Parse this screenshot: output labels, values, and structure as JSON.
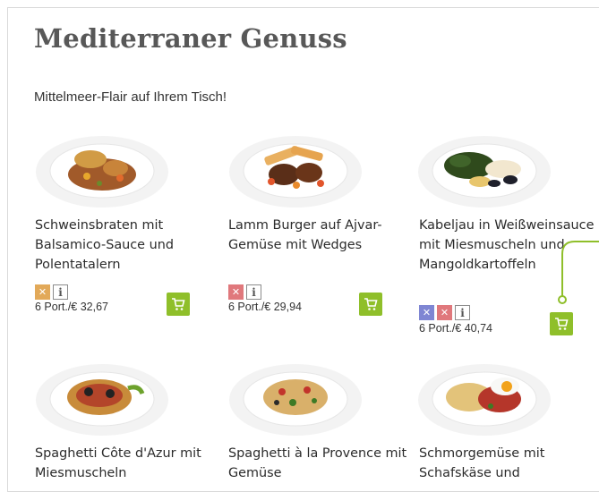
{
  "section": {
    "title": "Mediterraner Genuss",
    "subtitle": "Mittelmeer-Flair auf Ihrem Tisch!"
  },
  "products": [
    {
      "name": "Schweinsbraten mit Balsamico-Sauce und Polentatalern",
      "allergens": [
        "wheat-icon"
      ],
      "price": "6 Port./€ 32,67"
    },
    {
      "name": "Lamm Burger auf Ajvar-Gemüse mit Wedges",
      "allergens": [
        "milk-icon"
      ],
      "price": "6 Port./€ 29,94"
    },
    {
      "name": "Kabeljau in Weißweinsauce mit Miesmuscheln und Mangoldkartoffeln",
      "allergens": [
        "fish-icon",
        "milk-icon"
      ],
      "price": "6 Port./€ 40,74"
    },
    {
      "name": "Spaghetti Côte d'Azur mit Miesmuscheln"
    },
    {
      "name": "Spaghetti à la Provence mit Gemüse"
    },
    {
      "name": "Schmorgemüse mit Schafskäse und"
    }
  ],
  "colors": {
    "cart": "#8fbf2a",
    "connector": "#8fbf2a",
    "wheat": "#e2a959",
    "milk": "#e0787c",
    "fish": "#7f86d3"
  },
  "icons": {
    "info": "i",
    "cart": "cart-icon"
  }
}
